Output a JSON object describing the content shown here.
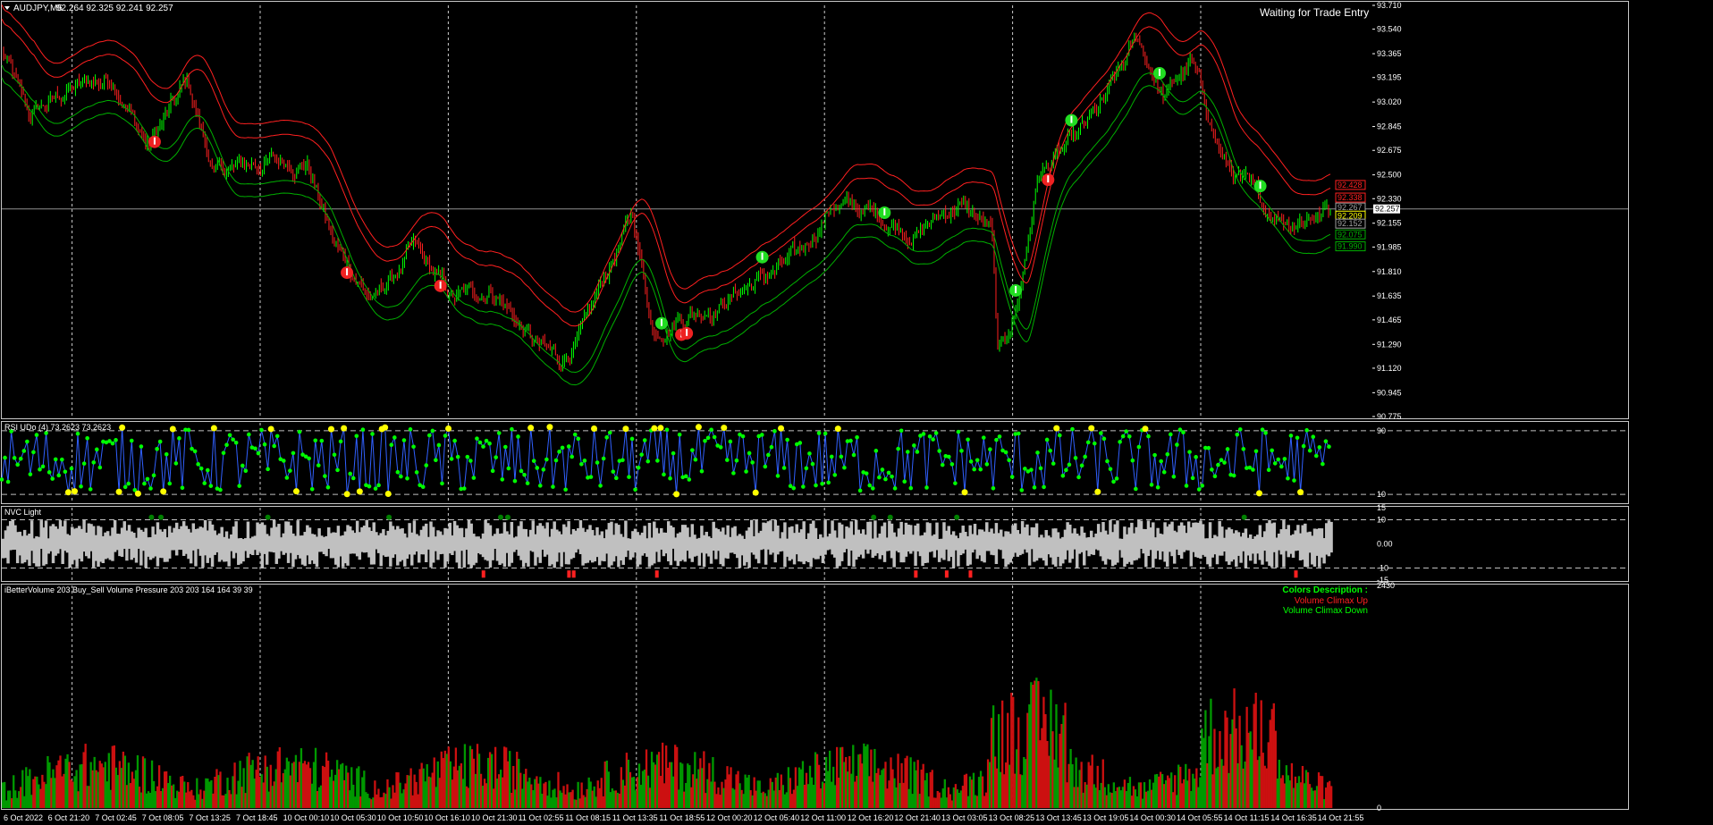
{
  "chart_data": [
    {
      "panel": "price",
      "type": "candlestick",
      "symbol_header": "AUDJPY,M5",
      "ohlc_text": "92.264 92.325 92.241 92.257",
      "status_text": "Waiting for Trade Entry",
      "y_ticks": [
        "93.710",
        "93.540",
        "93.365",
        "93.195",
        "93.020",
        "92.845",
        "92.675",
        "92.500",
        "92.330",
        "92.155",
        "91.985",
        "91.810",
        "91.635",
        "91.465",
        "91.290",
        "91.120",
        "90.945",
        "90.775"
      ],
      "ylim": [
        90.775,
        93.71
      ],
      "current_price": "92.257",
      "band_labels": [
        {
          "text": "92.428",
          "color": "#ff2020"
        },
        {
          "text": "92.338",
          "color": "#ff2020"
        },
        {
          "text": "92.267",
          "color": "#a0a0a0"
        },
        {
          "text": "92.209",
          "color": "#ffff00"
        },
        {
          "text": "92.152",
          "color": "#a0a0a0"
        },
        {
          "text": "92.075",
          "color": "#00b000"
        },
        {
          "text": "91.990",
          "color": "#00b000"
        }
      ],
      "price_path_approx": [
        {
          "x": 0.0,
          "y": 93.4
        },
        {
          "x": 0.02,
          "y": 92.9
        },
        {
          "x": 0.05,
          "y": 93.1
        },
        {
          "x": 0.085,
          "y": 93.2
        },
        {
          "x": 0.11,
          "y": 92.7
        },
        {
          "x": 0.14,
          "y": 93.15
        },
        {
          "x": 0.16,
          "y": 92.5
        },
        {
          "x": 0.2,
          "y": 92.6
        },
        {
          "x": 0.23,
          "y": 92.6
        },
        {
          "x": 0.25,
          "y": 92.0
        },
        {
          "x": 0.28,
          "y": 91.6
        },
        {
          "x": 0.31,
          "y": 91.95
        },
        {
          "x": 0.34,
          "y": 91.6
        },
        {
          "x": 0.37,
          "y": 91.7
        },
        {
          "x": 0.4,
          "y": 91.3
        },
        {
          "x": 0.42,
          "y": 91.15
        },
        {
          "x": 0.44,
          "y": 91.4
        },
        {
          "x": 0.46,
          "y": 91.9
        },
        {
          "x": 0.475,
          "y": 92.2
        },
        {
          "x": 0.49,
          "y": 91.4
        },
        {
          "x": 0.51,
          "y": 91.5
        },
        {
          "x": 0.54,
          "y": 91.6
        },
        {
          "x": 0.57,
          "y": 91.75
        },
        {
          "x": 0.6,
          "y": 91.9
        },
        {
          "x": 0.625,
          "y": 92.3
        },
        {
          "x": 0.66,
          "y": 92.2
        },
        {
          "x": 0.69,
          "y": 92.1
        },
        {
          "x": 0.72,
          "y": 92.3
        },
        {
          "x": 0.745,
          "y": 92.1
        },
        {
          "x": 0.75,
          "y": 91.15
        },
        {
          "x": 0.765,
          "y": 91.6
        },
        {
          "x": 0.78,
          "y": 92.5
        },
        {
          "x": 0.81,
          "y": 92.75
        },
        {
          "x": 0.83,
          "y": 93.0
        },
        {
          "x": 0.855,
          "y": 93.45
        },
        {
          "x": 0.875,
          "y": 93.05
        },
        {
          "x": 0.895,
          "y": 93.3
        },
        {
          "x": 0.92,
          "y": 92.6
        },
        {
          "x": 0.95,
          "y": 92.25
        },
        {
          "x": 0.97,
          "y": 92.2
        },
        {
          "x": 1.0,
          "y": 92.26
        }
      ]
    },
    {
      "panel": "rsi",
      "type": "line",
      "header": "RSI UDo (4) 73.2623 73.2623",
      "y_ticks": [
        "90",
        "10"
      ],
      "ylim": [
        0,
        100
      ],
      "levels": [
        90,
        10
      ]
    },
    {
      "panel": "nvc",
      "type": "bar",
      "header": "NVC Light",
      "y_ticks": [
        "15",
        "10",
        "0.00",
        "-10",
        "-15"
      ],
      "ylim": [
        -15,
        15
      ],
      "levels": [
        10,
        -10
      ]
    },
    {
      "panel": "volume",
      "type": "bar",
      "header": "iBetterVolume 203  Buy_Sell Volume Pressure 203 203 164 164 39 39",
      "y_ticks": [
        "2430",
        "0"
      ],
      "ylim": [
        0,
        2430
      ],
      "legend": [
        {
          "text": "Colors Description :",
          "color": "#00ff00"
        },
        {
          "text": "Volume Climax Up",
          "color": "#ff2020"
        },
        {
          "text": "Volume Climax Down",
          "color": "#00ff00"
        }
      ]
    }
  ],
  "time_axis": {
    "labels": [
      "6 Oct 2022",
      "6 Oct 21:20",
      "7 Oct 02:45",
      "7 Oct 08:05",
      "7 Oct 13:25",
      "7 Oct 18:45",
      "10 Oct 00:10",
      "10 Oct 05:30",
      "10 Oct 10:50",
      "10 Oct 16:10",
      "10 Oct 21:30",
      "11 Oct 02:55",
      "11 Oct 08:15",
      "11 Oct 13:35",
      "11 Oct 18:55",
      "12 Oct 00:20",
      "12 Oct 05:40",
      "12 Oct 11:00",
      "12 Oct 16:20",
      "12 Oct 21:40",
      "13 Oct 03:05",
      "13 Oct 08:25",
      "13 Oct 13:45",
      "13 Oct 19:05",
      "14 Oct 00:30",
      "14 Oct 05:55",
      "14 Oct 11:15",
      "14 Oct 16:35",
      "14 Oct 21:55"
    ]
  },
  "colors": {
    "background": "#000000",
    "grid": "#ffffff",
    "bull_candle": "#00ff00",
    "bear_candle": "#ff2020",
    "upper_band": "#ff2020",
    "lower_band": "#00b000",
    "rsi_line": "#3060ff",
    "rsi_dot": "#00ff00",
    "rsi_extreme_dot": "#ffff00",
    "nvc_bar": "#c0c0c0",
    "nvc_up": "#008000",
    "nvc_down": "#ff2020",
    "axis_text": "#ffffff"
  }
}
